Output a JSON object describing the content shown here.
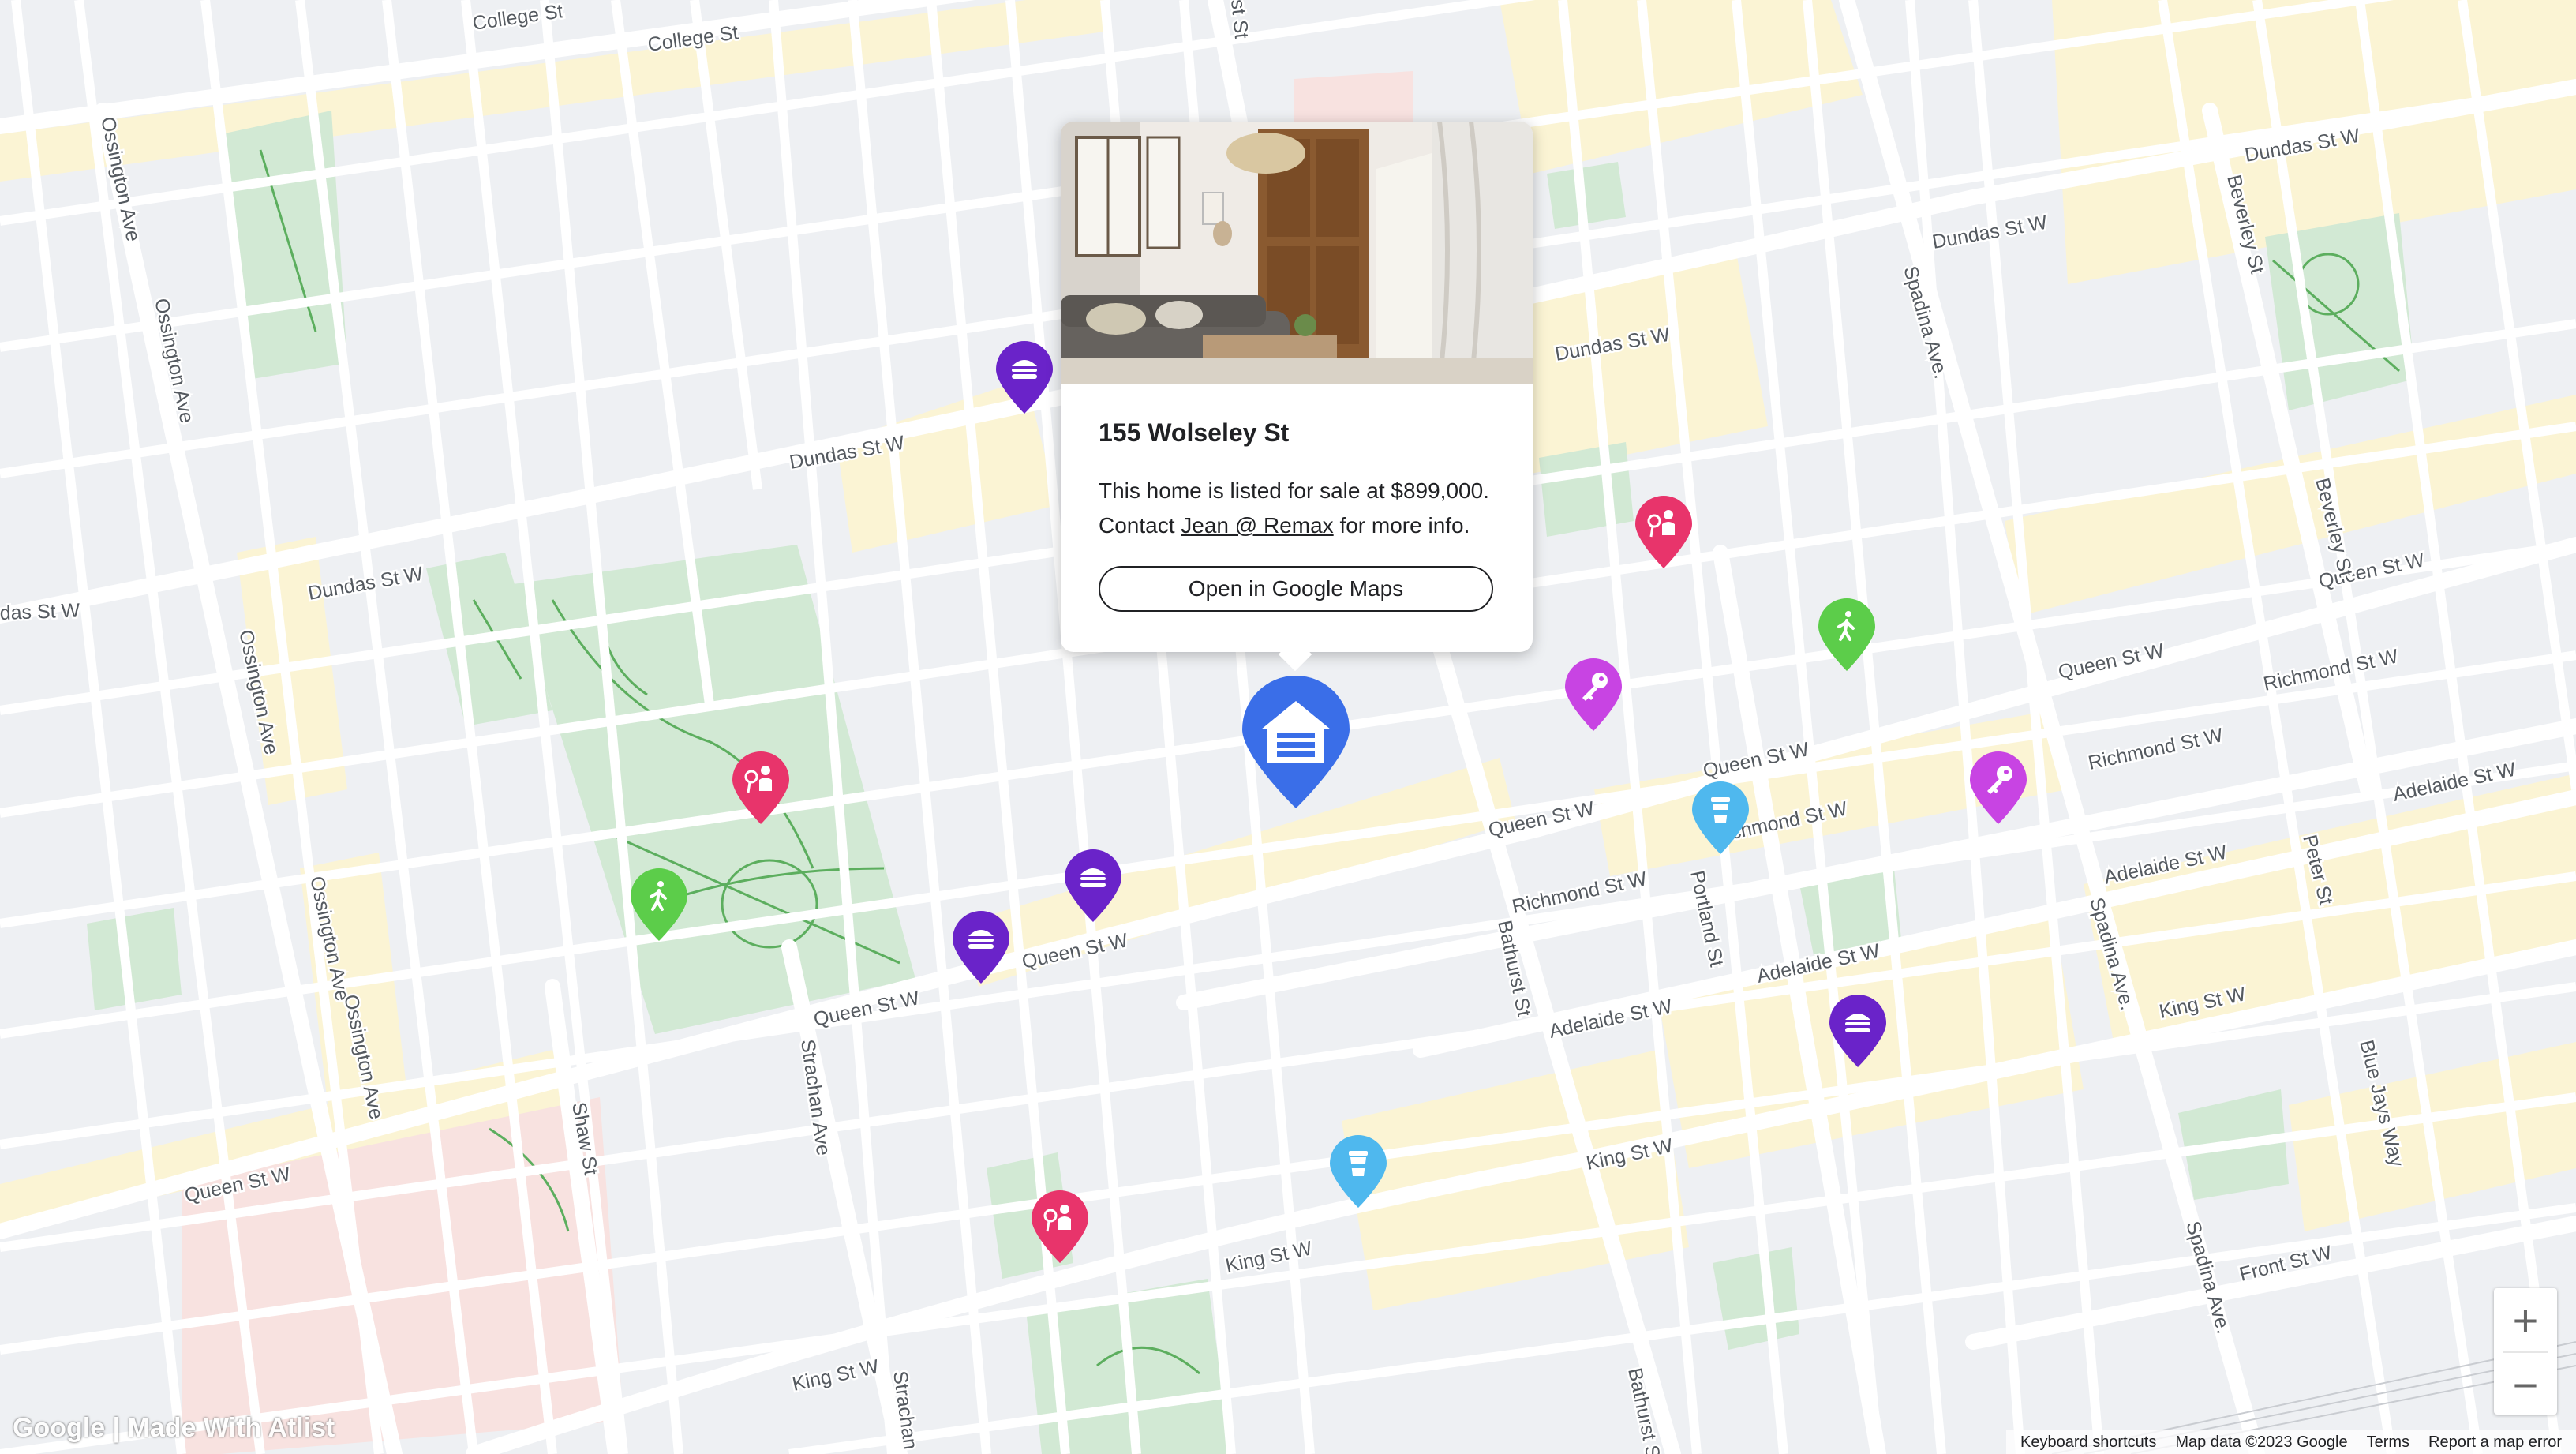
{
  "map": {
    "attribution": "Google | Made With Atlist",
    "background": "#eef0f3",
    "park_color": "#d2e9d4",
    "building_color": "#fbf4d4"
  },
  "streets": {
    "college_1": "College St",
    "college_2": "College St",
    "dundas_w_1": "Dundas St W",
    "dundas_w_2": "Dundas St W",
    "dundas_w_3": "Dundas St W",
    "dundas_w_4": "Dundas St W",
    "dundas_w_5": "Dundas St W",
    "dundas_w_6": "Dundas St W",
    "dundas_w_edge": "das St W",
    "queen_w_1": "Queen St W",
    "queen_w_2": "Queen St W",
    "queen_w_3": "Queen St W",
    "queen_w_4": "Queen St W",
    "queen_w_5": "Queen St W",
    "queen_w_6": "Queen St W",
    "queen_w_7": "Queen St W",
    "richmond_w_1": "Richmond St W",
    "richmond_w_2": "Richmond St W",
    "richmond_w_3": "Richmond St W",
    "richmond_w_4": "Richmond St W",
    "adelaide_w_1": "Adelaide St W",
    "adelaide_w_2": "Adelaide St W",
    "adelaide_w_3": "Adelaide St W",
    "adelaide_w_4": "Adelaide St W",
    "king_w_1": "King St W",
    "king_w_2": "King St W",
    "king_w_3": "King St W",
    "king_w_4": "King St W",
    "front_w": "Front St W",
    "ossington_1": "Ossington Ave",
    "ossington_2": "Ossington Ave",
    "ossington_3": "Ossington Ave",
    "ossington_4": "Ossington Ave",
    "ossington_5": "Ossington Ave",
    "shaw": "Shaw St",
    "strachan_1": "Strachan Ave",
    "strachan_2": "Strachan",
    "bathurst_1": "Bathurst St",
    "bathurst_2": "Bathurst S",
    "bathurst_top": "st St",
    "portland": "Portland St",
    "spadina_1": "Spadina Ave.",
    "spadina_2": "Spadina Ave.",
    "spadina_3": "Spadina Ave.",
    "peter": "Peter St",
    "blue_jays": "Blue Jays Way",
    "beverley_1": "Beverley St",
    "beverley_2": "Beverley St"
  },
  "popup": {
    "title": "155 Wolseley St",
    "desc_prefix": "This home is listed for sale at $899,000. Contact ",
    "contact_link": "Jean @ Remax",
    "desc_suffix": " for more info.",
    "button_label": "Open in Google Maps"
  },
  "markers": [
    {
      "type": "food",
      "color": "#6a23c9",
      "icon": "burger-icon"
    },
    {
      "type": "food",
      "color": "#6a23c9",
      "icon": "burger-icon"
    },
    {
      "type": "food",
      "color": "#6a23c9",
      "icon": "burger-icon"
    },
    {
      "type": "food",
      "color": "#6a23c9",
      "icon": "burger-icon"
    },
    {
      "type": "school",
      "color": "#e8346b",
      "icon": "teacher-icon"
    },
    {
      "type": "school",
      "color": "#e8346b",
      "icon": "teacher-icon"
    },
    {
      "type": "school",
      "color": "#e8346b",
      "icon": "teacher-icon"
    },
    {
      "type": "walk",
      "color": "#5ccd4a",
      "icon": "walking-person-icon"
    },
    {
      "type": "walk",
      "color": "#5ccd4a",
      "icon": "walking-person-icon"
    },
    {
      "type": "key",
      "color": "#c844e3",
      "icon": "key-icon"
    },
    {
      "type": "key",
      "color": "#c844e3",
      "icon": "key-icon"
    },
    {
      "type": "coffee",
      "color": "#4fb8ee",
      "icon": "coffee-cup-icon"
    },
    {
      "type": "coffee",
      "color": "#4fb8ee",
      "icon": "coffee-cup-icon"
    }
  ],
  "home_marker": {
    "color": "#3a6ee8",
    "icon": "garage-house-icon"
  },
  "controls": {
    "zoom_in": "+",
    "zoom_out": "−"
  },
  "footer": {
    "shortcuts": "Keyboard shortcuts",
    "map_data": "Map data ©2023 Google",
    "terms": "Terms",
    "report": "Report a map error"
  }
}
